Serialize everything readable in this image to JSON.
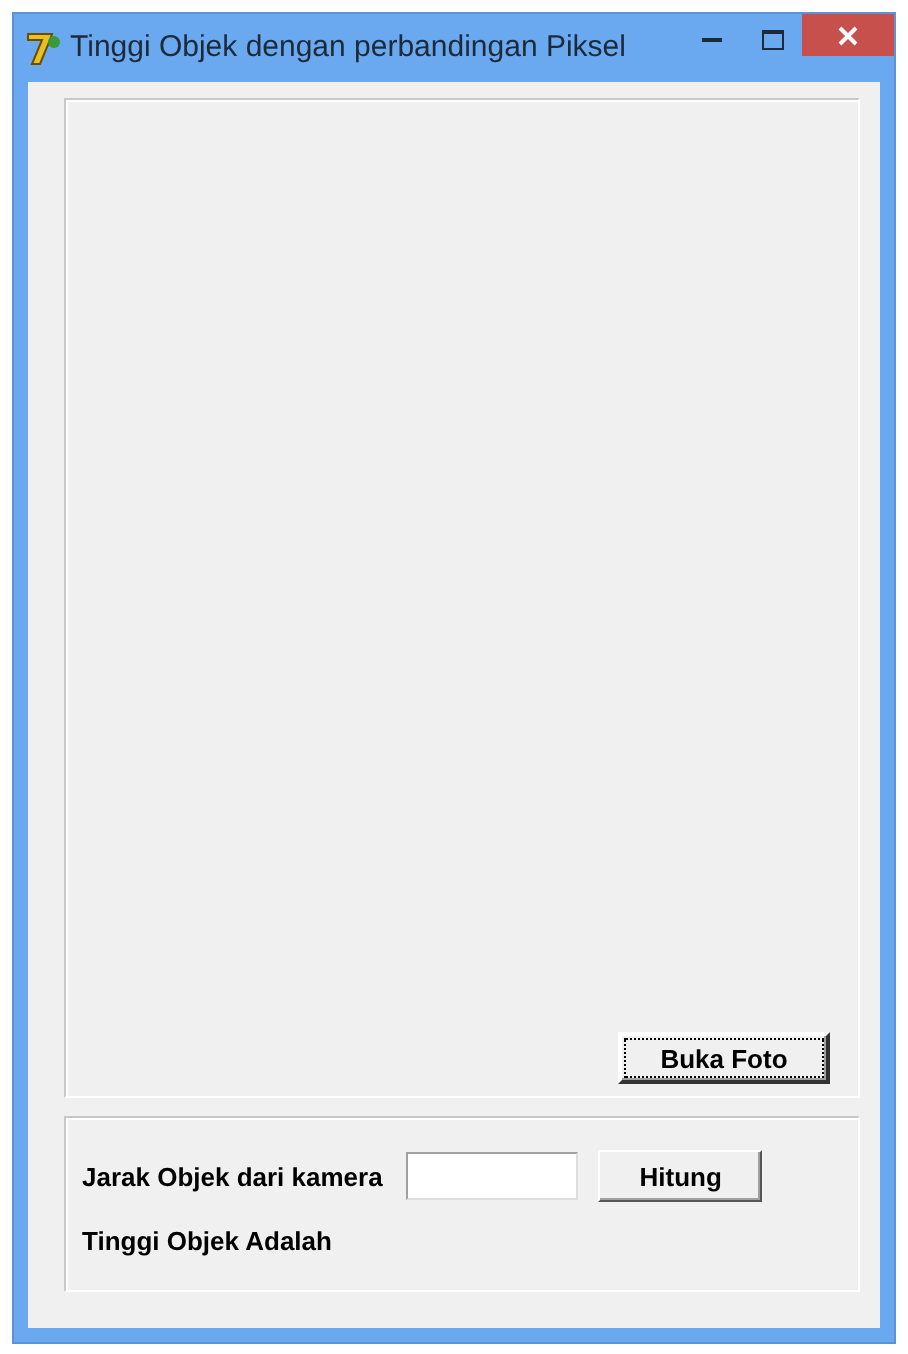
{
  "window": {
    "title": "Tinggi Objek dengan perbandingan Piksel"
  },
  "photo_panel": {
    "button": "Buka Foto"
  },
  "calc_panel": {
    "distance_label": "Jarak Objek dari kamera",
    "calculate_button": "Hitung",
    "result_label": "Tinggi Objek Adalah"
  }
}
